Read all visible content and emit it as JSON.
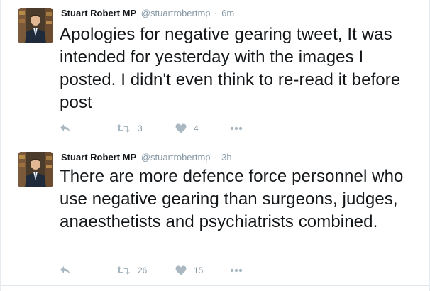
{
  "tweets": [
    {
      "fullname": "Stuart Robert MP",
      "username": "@stuartrobertmp",
      "separator": "·",
      "time": "6m",
      "text": "Apologies for negative gearing tweet, It was intended for yesterday with the images I posted. I didn't even think to re-read it before post",
      "retweets": "3",
      "likes": "4"
    },
    {
      "fullname": "Stuart Robert MP",
      "username": "@stuartrobertmp",
      "separator": "·",
      "time": "3h",
      "text": "There are more defence force personnel who use negative gearing than surgeons, judges, anaesthetists and psychiatrists combined.",
      "retweets": "26",
      "likes": "15"
    }
  ],
  "icons": {
    "reply": "reply-icon",
    "retweet": "retweet-icon",
    "like": "heart-icon",
    "more": "more-icon"
  },
  "colors": {
    "icon": "#aab8c2",
    "meta": "#8899a6",
    "text": "#14171a",
    "divider": "#e1e8ed"
  }
}
